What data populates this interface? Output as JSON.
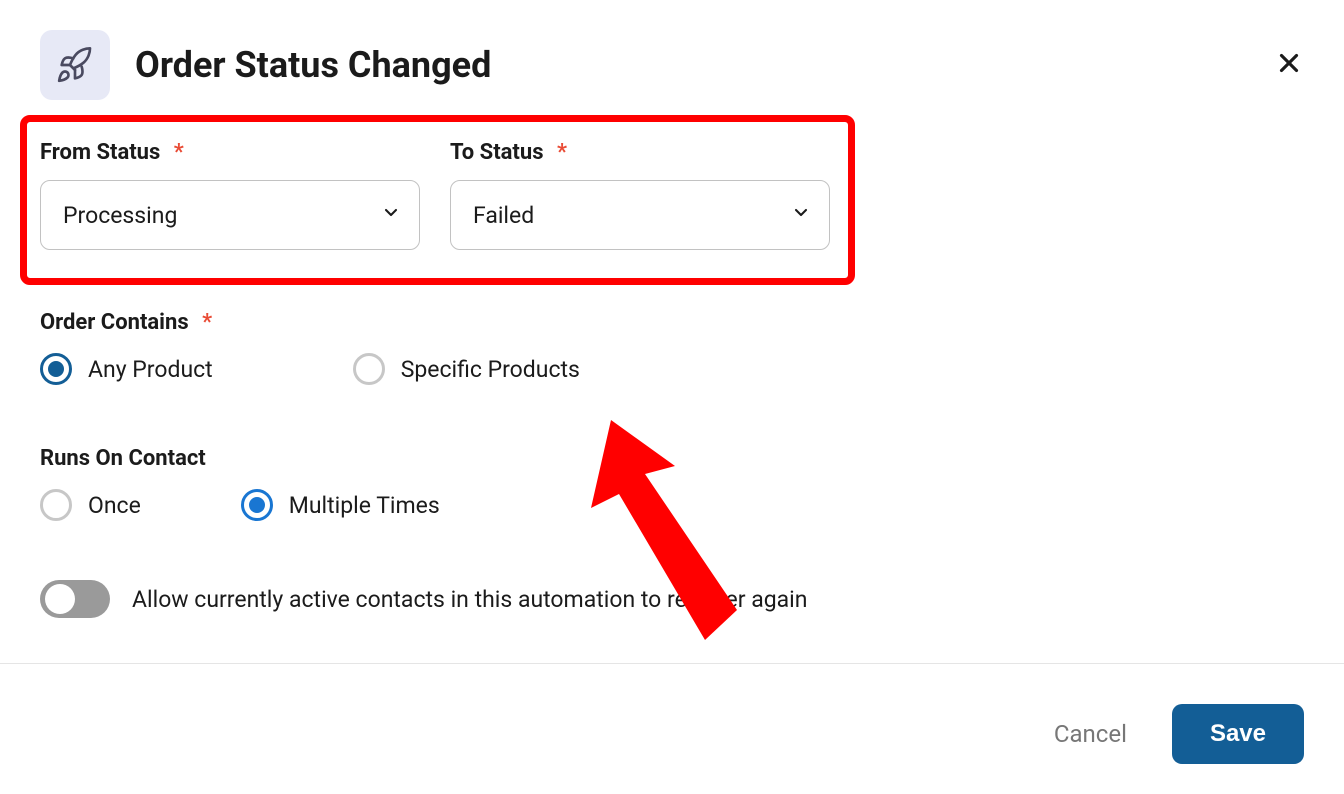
{
  "header": {
    "title": "Order Status Changed",
    "icon": "rocket-icon"
  },
  "status": {
    "from_label": "From Status",
    "from_value": "Processing",
    "to_label": "To Status",
    "to_value": "Failed"
  },
  "order_contains": {
    "label": "Order Contains",
    "options": {
      "any": "Any Product",
      "specific": "Specific Products"
    },
    "selected": "any"
  },
  "runs_on": {
    "label": "Runs On Contact",
    "options": {
      "once": "Once",
      "multiple": "Multiple Times"
    },
    "selected": "multiple"
  },
  "allow_reenter": {
    "label": "Allow currently active contacts in this automation to re-enter again",
    "value": false
  },
  "footer": {
    "cancel": "Cancel",
    "save": "Save"
  },
  "annotation": {
    "highlight": "status-selectors",
    "arrow_target": "status-selectors"
  }
}
